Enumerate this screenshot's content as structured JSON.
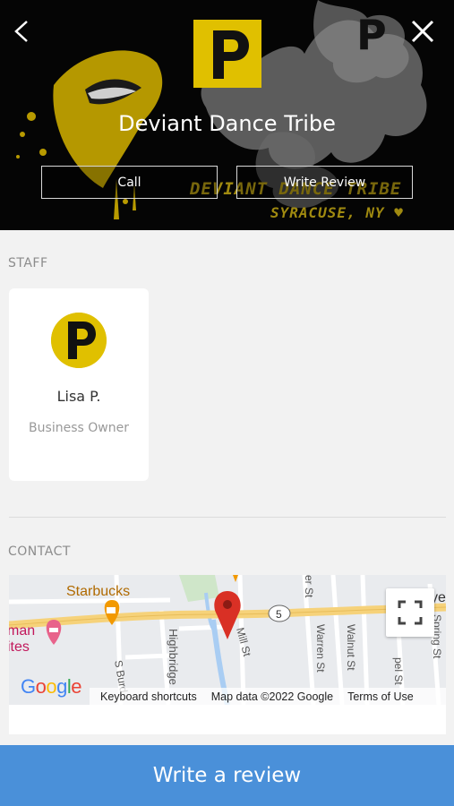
{
  "header": {
    "business_name": "Deviant Dance Tribe",
    "logo_letter": "P",
    "call_label": "Call",
    "write_review_label": "Write Review",
    "graffiti_line1": "DEVIANT DANCE TRIBE",
    "graffiti_line2": "SYRACUSE, NY ♥"
  },
  "staff": {
    "section_label": "STAFF",
    "members": [
      {
        "name": "Lisa P.",
        "role": "Business Owner",
        "avatar_letter": "P"
      }
    ]
  },
  "contact": {
    "section_label": "CONTACT",
    "map": {
      "poi_starbucks": "Starbucks",
      "poi_hotel_line1": "man",
      "poi_hotel_line2": "ites",
      "road_badge": "5",
      "streets": [
        "Highbridge",
        "Mill St",
        "Warren St",
        "Walnut St",
        "S Burd",
        "er St",
        "pel St",
        "Spring St",
        "ye"
      ],
      "google_logo": "Google",
      "keyboard_shortcuts": "Keyboard shortcuts",
      "map_data": "Map data ©2022 Google",
      "terms": "Terms of Use"
    }
  },
  "bottom_bar": {
    "label": "Write a review"
  },
  "colors": {
    "accent_yellow": "#e0c000",
    "bottom_bar": "#4a90d9",
    "marker_red": "#d93025",
    "road_yellow": "#f6d27a"
  },
  "icons": [
    "back-chevron-icon",
    "close-icon",
    "fullscreen-icon",
    "map-pin-icon",
    "coffee-icon",
    "hotel-icon"
  ]
}
